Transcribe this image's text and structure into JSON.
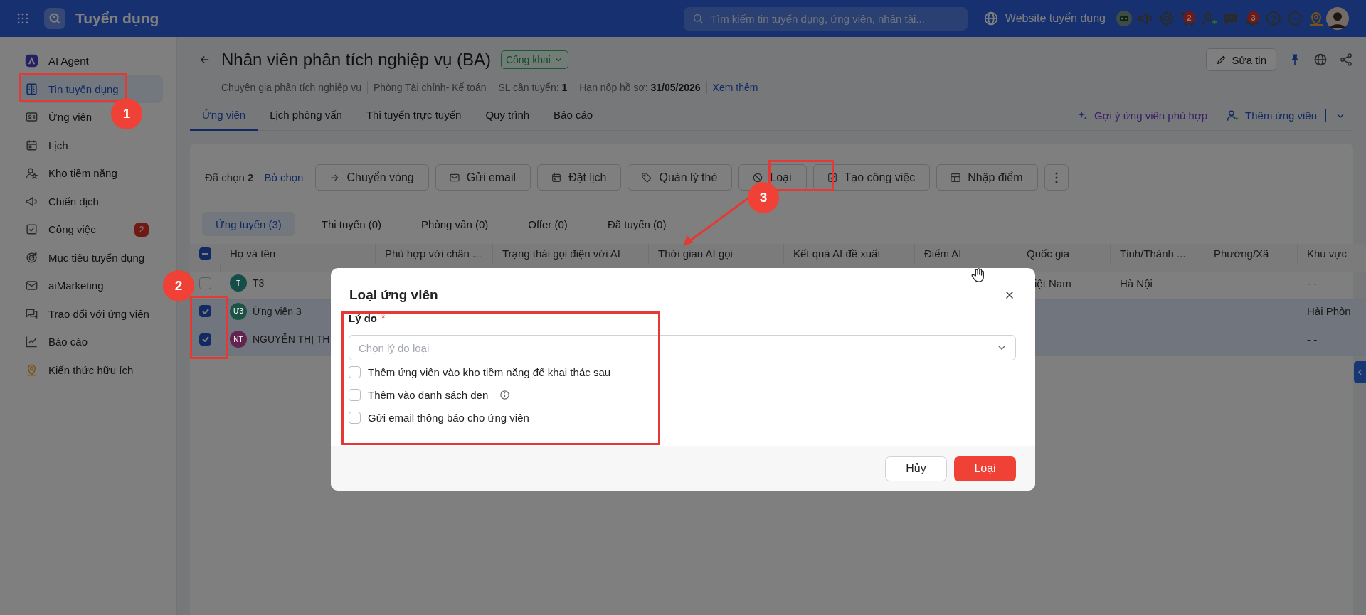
{
  "topbar": {
    "app_title": "Tuyển dụng",
    "search": {
      "placeholder": "Tìm kiếm tin tuyển dụng, ứng viên, nhân tài..."
    },
    "website_link": "Website tuyển dụng",
    "icons": [
      {
        "kind": "robot"
      },
      {
        "kind": "megaphone"
      },
      {
        "kind": "gear"
      },
      {
        "kind": "cart",
        "badge": "2"
      },
      {
        "kind": "user-plus"
      },
      {
        "kind": "chat"
      },
      {
        "kind": "bell",
        "badge": "3"
      },
      {
        "kind": "help"
      },
      {
        "kind": "more"
      },
      {
        "kind": "map-pin"
      },
      {
        "kind": "avatar"
      }
    ]
  },
  "sidebar": {
    "items": [
      {
        "label": "AI Agent",
        "kind": "agent",
        "selected": false
      },
      {
        "label": "Tin tuyển dụng",
        "kind": "doc",
        "selected": true
      },
      {
        "label": "Ứng viên",
        "kind": "idcard",
        "selected": false
      },
      {
        "label": "Lịch",
        "kind": "calendar",
        "selected": false
      },
      {
        "label": "Kho tiềm năng",
        "kind": "user-star",
        "selected": false
      },
      {
        "label": "Chiến dịch",
        "kind": "megaphone",
        "selected": false
      },
      {
        "label": "Công việc",
        "kind": "check-square",
        "selected": false,
        "badge": "2"
      },
      {
        "label": "Mục tiêu tuyển dụng",
        "kind": "target",
        "selected": false
      },
      {
        "label": "aiMarketing",
        "kind": "mail",
        "selected": false
      },
      {
        "label": "Trao đổi với ứng viên",
        "kind": "chat-bubbles",
        "selected": false
      },
      {
        "label": "Báo cáo",
        "kind": "chart",
        "selected": false
      },
      {
        "label": "Kiến thức hữu ích",
        "kind": "bulb-map",
        "selected": false
      }
    ]
  },
  "job": {
    "title": "Nhân viên phân tích nghiệp vụ (BA)",
    "status": "Công khai",
    "edit_button": "Sửa tin",
    "meta": [
      "Chuyên gia phân tích nghiệp vụ",
      "Phòng Tài chính- Kế toán",
      "SL cần tuyển: **1**",
      "Hạn nộp hồ sơ: **31/05/2026**"
    ],
    "more_link": "Xem thêm"
  },
  "tabs": [
    {
      "label": "Ứng viên",
      "selected": true
    },
    {
      "label": "Lịch phỏng vấn",
      "selected": false
    },
    {
      "label": "Thi tuyển trực tuyến",
      "selected": false
    },
    {
      "label": "Quy trình",
      "selected": false
    },
    {
      "label": "Báo cáo",
      "selected": false
    }
  ],
  "actions": {
    "suggest": "Gợi ý ứng viên phù hợp",
    "add": "Thêm ứng viên"
  },
  "selection": {
    "summary": "Đã chọn **2**",
    "clear": "Bỏ chọn",
    "buttons": [
      {
        "label": "Chuyển vòng",
        "kind": "arrow-right"
      },
      {
        "label": "Gửi email",
        "kind": "mail"
      },
      {
        "label": "Đặt lịch",
        "kind": "calendar"
      },
      {
        "label": "Quản lý thẻ",
        "kind": "tag"
      },
      {
        "label": "Loại",
        "kind": "ban"
      },
      {
        "label": "Tạo công việc",
        "kind": "check-square"
      },
      {
        "label": "Nhập điểm",
        "kind": "table"
      },
      {
        "kind": "more-v"
      }
    ]
  },
  "stage_tabs": [
    {
      "label": "Ứng tuyển (3)",
      "selected": true
    },
    {
      "label": "Thi tuyển (0)",
      "selected": false
    },
    {
      "label": "Phỏng vấn (0)",
      "selected": false
    },
    {
      "label": "Offer (0)",
      "selected": false
    },
    {
      "label": "Đã tuyển (0)",
      "selected": false
    }
  ],
  "table": {
    "header_partial": true,
    "columns": [
      "Họ và tên",
      "Phù hợp với chân ...",
      "Trạng thái gọi điện với AI",
      "Thời gian AI gọi",
      "Kết quả AI đề xuất",
      "Điểm AI",
      "Quốc gia",
      "Tỉnh/Thành ...",
      "Phường/Xã",
      "Khu vực"
    ],
    "rows": [
      {
        "checked": false,
        "selected": false,
        "initials": "T",
        "color": "#154e48",
        "name": "T3",
        "country": "iệt Nam",
        "province": "Hà Nội",
        "region": "- -"
      },
      {
        "checked": true,
        "selected": true,
        "initials": "Ư3",
        "color": "#1d5345",
        "name": "Ứng viên 3",
        "region": "Hải Phòn"
      },
      {
        "checked": true,
        "selected": true,
        "initials": "NT",
        "color": "#62254f",
        "name": "NGUYỄN THỊ TH",
        "region": "- -"
      }
    ]
  },
  "dialog": {
    "title": "Loại ứng viên",
    "reason_label": "Lý do",
    "required_mark": "*",
    "reason_select": {
      "placeholder": "Chọn lý do loại"
    },
    "options": [
      {
        "label": "Thêm ứng viên vào kho tiềm năng để khai thác sau",
        "checked": false,
        "info": false
      },
      {
        "label": "Thêm vào danh sách đen",
        "checked": false,
        "info": true
      },
      {
        "label": "Gửi email thông báo cho ứng viên",
        "checked": false,
        "info": false
      }
    ],
    "cancel": "Hủy",
    "confirm": "Loại"
  },
  "callouts": [
    "1",
    "2",
    "3"
  ]
}
